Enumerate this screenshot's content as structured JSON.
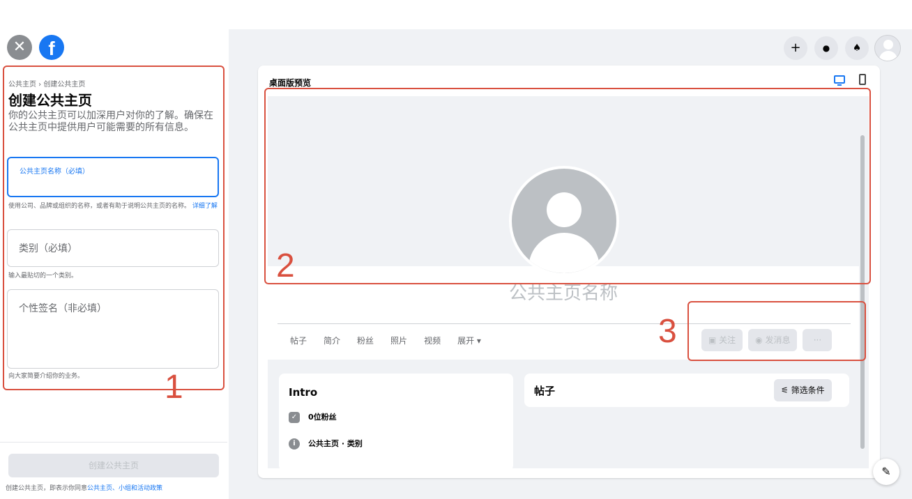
{
  "header": {
    "close_icon": "close-icon",
    "logo": "f"
  },
  "form": {
    "breadcrumb": "公共主页 › 创建公共主页",
    "title": "创建公共主页",
    "description": "你的公共主页可以加深用户对你的了解。确保在公共主页中提供用户可能需要的所有信息。",
    "name_label": "公共主页名称（必填）",
    "name_helper": "使用公司、品牌或组织的名称，或者有助于说明公共主页的名称。",
    "name_helper_link": "详细了解",
    "category_placeholder": "类别（必填）",
    "category_helper": "输入最贴切的一个类别。",
    "bio_placeholder": "个性签名（非必填）",
    "bio_helper": "向大家简要介绍你的业务。",
    "create_button": "创建公共主页",
    "terms_prefix": "创建公共主页，即表示你同意",
    "terms_link": "公共主页、小组和活动政策"
  },
  "topbar": {
    "plus": "+",
    "messenger": "●",
    "bell": "♠"
  },
  "preview": {
    "title": "桌面版预览",
    "page_name": "公共主页名称",
    "tabs": [
      "帖子",
      "简介",
      "粉丝",
      "照片",
      "视频",
      "展开 ▾"
    ],
    "follow_button": "▣ 关注",
    "message_button": "◉ 发消息",
    "more_button": "···",
    "intro_title": "Intro",
    "followers": "0位粉丝",
    "category_line": "公共主页 · 类别",
    "posts_title": "帖子",
    "filter_button": "⚟ 筛选条件"
  },
  "annotations": {
    "n1": "1",
    "n2": "2",
    "n3": "3"
  },
  "colors": {
    "accent": "#1877f2",
    "annotation": "#d9503f"
  }
}
